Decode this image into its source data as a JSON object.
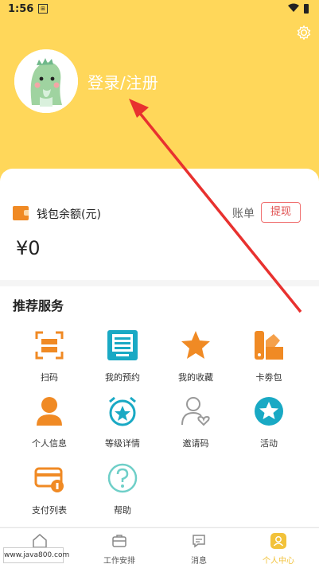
{
  "status": {
    "time": "1:56",
    "notif_glyph": "⊞"
  },
  "profile": {
    "login_text": "登录/注册"
  },
  "wallet": {
    "label": "钱包余额(元)",
    "bill": "账单",
    "recharge": "提现",
    "balance": "¥0"
  },
  "services": {
    "title": "推荐服务",
    "items": [
      {
        "label": "扫码"
      },
      {
        "label": "我的预约"
      },
      {
        "label": "我的收藏"
      },
      {
        "label": "卡劵包"
      },
      {
        "label": "个人信息"
      },
      {
        "label": "等级详情"
      },
      {
        "label": "邀请码"
      },
      {
        "label": "活动"
      },
      {
        "label": "支付列表"
      },
      {
        "label": "帮助"
      }
    ]
  },
  "tabbar": {
    "items": [
      {
        "label": ""
      },
      {
        "label": "工作安排"
      },
      {
        "label": "消息"
      },
      {
        "label": "个人中心"
      }
    ]
  },
  "watermark": "www.java800.com",
  "colors": {
    "header": "#ffd75a",
    "accent_orange": "#f08a24",
    "accent_teal": "#19a9c4",
    "active_tab": "#f2c23a",
    "arrow": "#e8312f"
  }
}
